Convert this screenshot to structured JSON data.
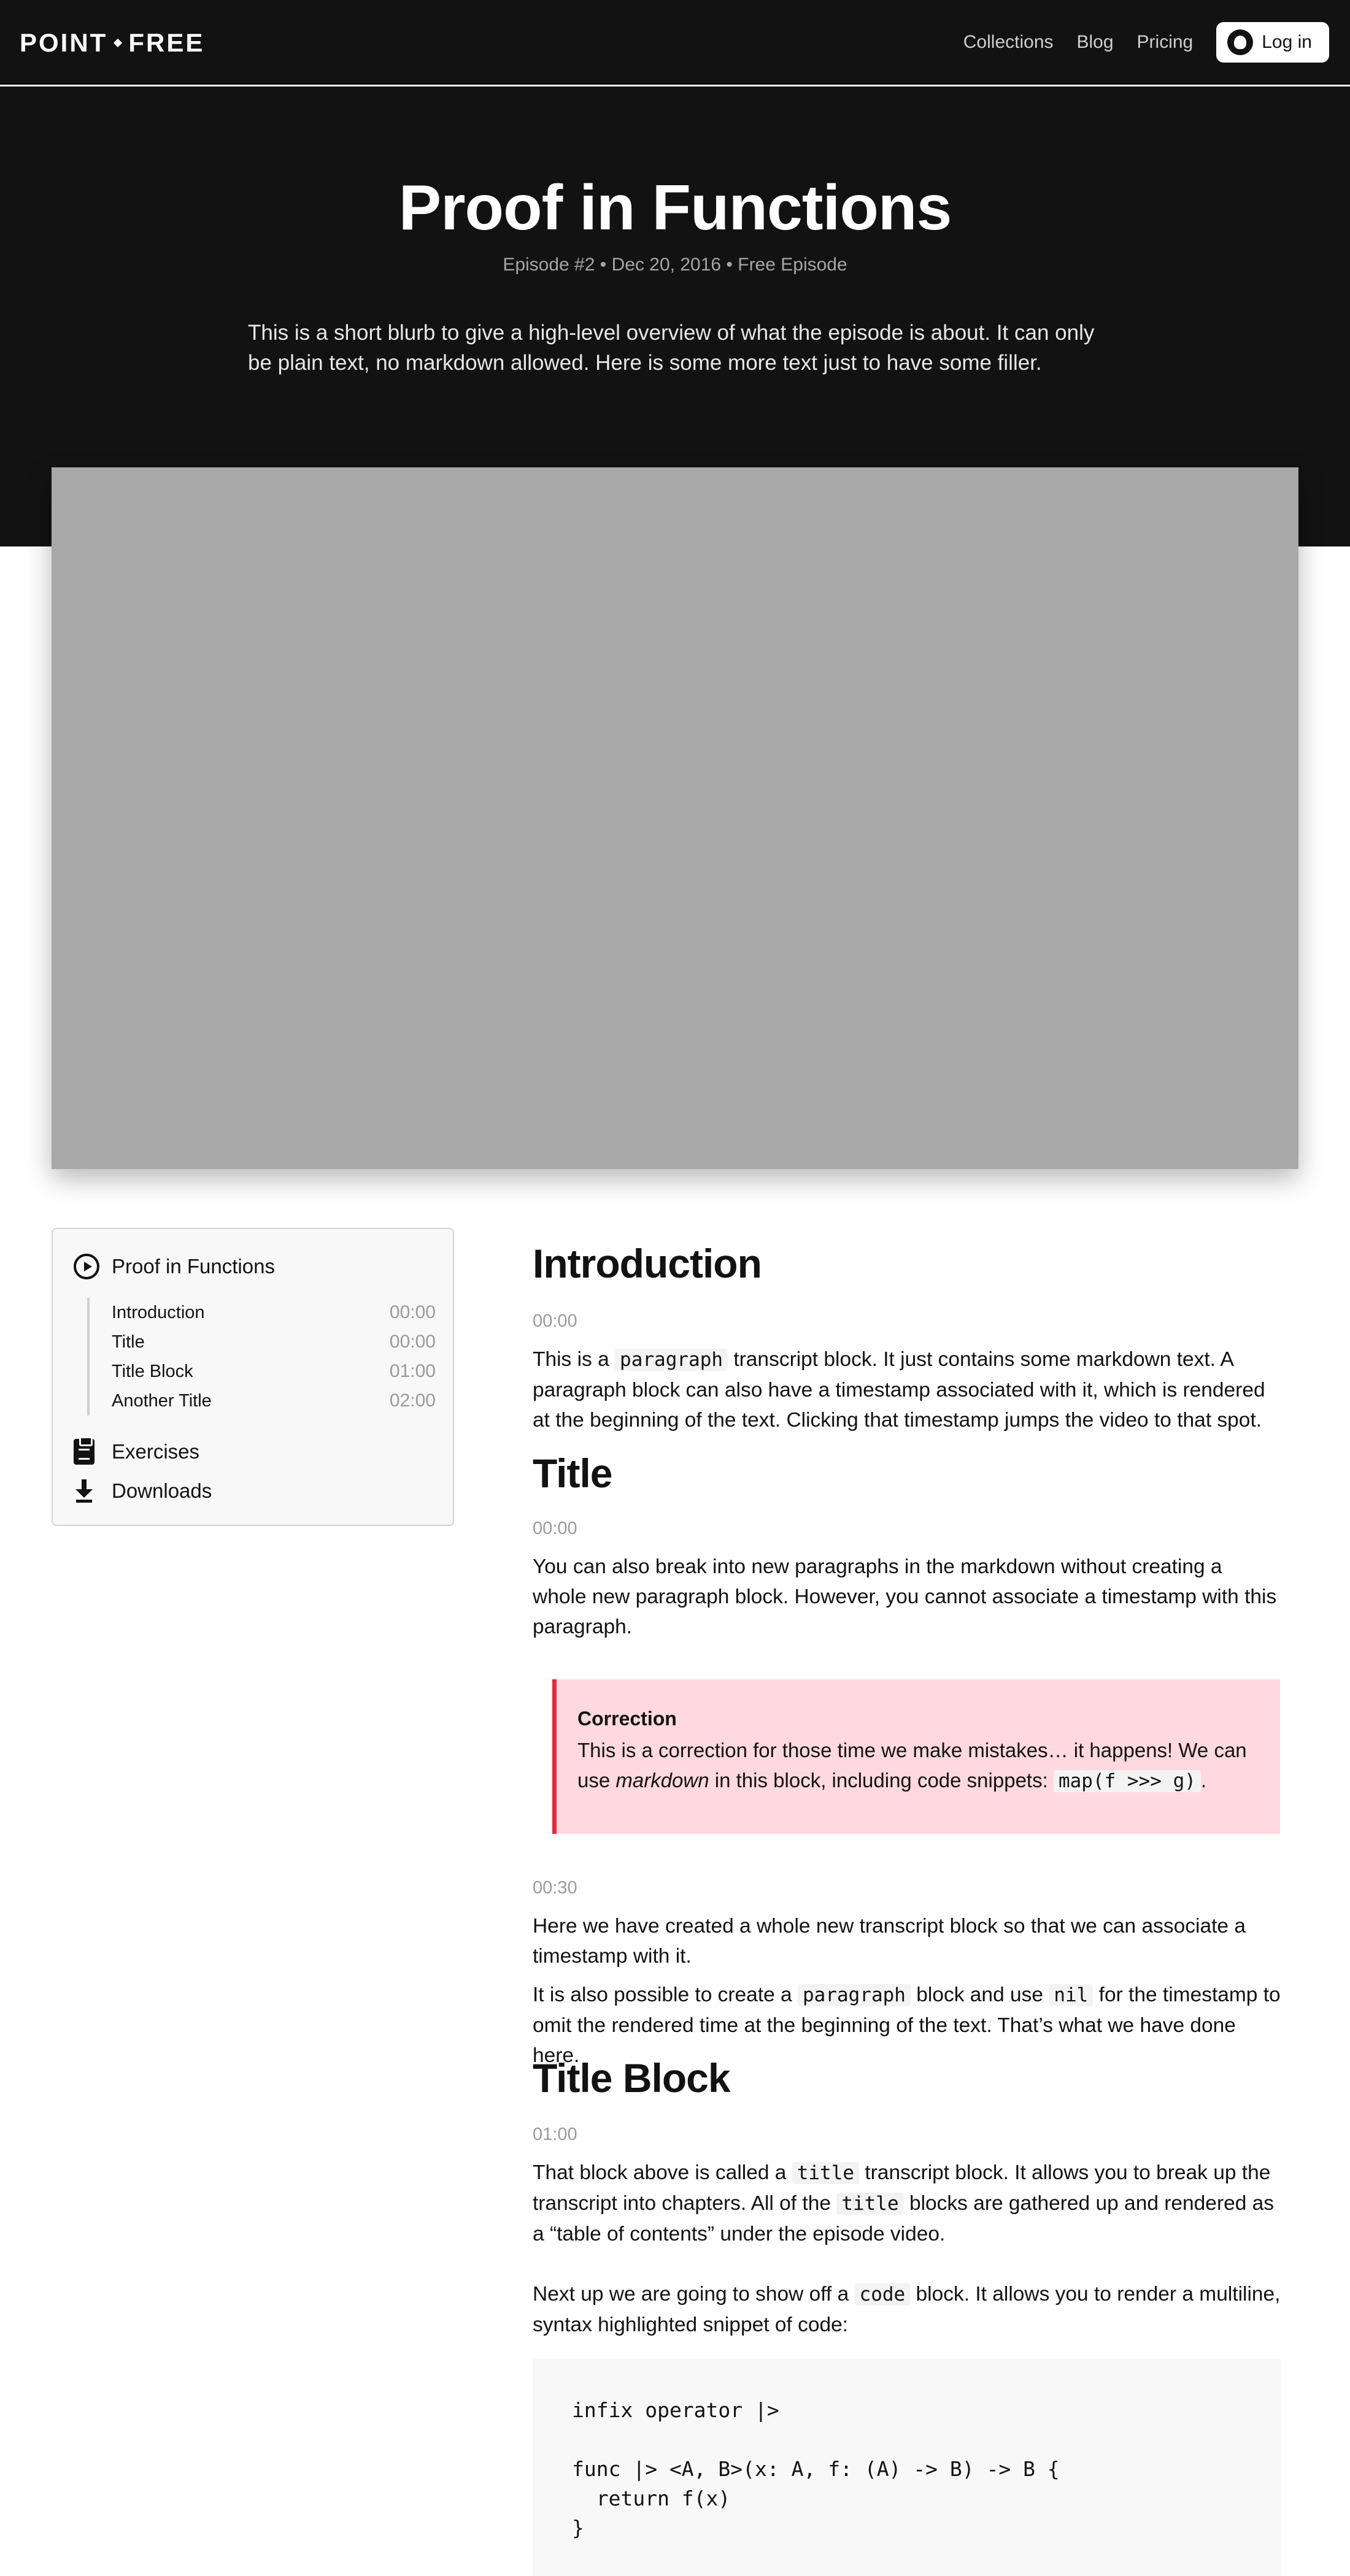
{
  "nav": {
    "logo_left": "POINT",
    "logo_right": "FREE",
    "links": [
      "Collections",
      "Blog",
      "Pricing"
    ],
    "login_label": "Log in"
  },
  "hero": {
    "title": "Proof in Functions",
    "meta": "Episode #2 • Dec 20, 2016 • Free Episode",
    "blurb": "This is a short blurb to give a high-level overview of what the episode is about. It can only be plain text, no markdown allowed. Here is some more text just to have some filler."
  },
  "toc": {
    "episode_title": "Proof in Functions",
    "chapters": [
      {
        "title": "Introduction",
        "time": "00:00"
      },
      {
        "title": "Title",
        "time": "00:00"
      },
      {
        "title": "Title Block",
        "time": "01:00"
      },
      {
        "title": "Another Title",
        "time": "02:00"
      }
    ],
    "exercises_label": "Exercises",
    "downloads_label": "Downloads"
  },
  "transcript": {
    "intro": {
      "heading": "Introduction",
      "time": "00:00",
      "p_a": "This is a ",
      "p_code": "paragraph",
      "p_b": " transcript block. It just contains some markdown text. A paragraph block can also have a timestamp associated with it, which is rendered at the beginning of the text. Clicking that timestamp jumps the video to that spot."
    },
    "title_section": {
      "heading": "Title",
      "time": "00:00",
      "p": "You can also break into new paragraphs in the markdown without creating a whole new paragraph block. However, you cannot associate a timestamp with this paragraph."
    },
    "correction": {
      "title": "Correction",
      "body_a": "This is a correction for those time we make mistakes… it happens! We can use ",
      "body_em": "markdown",
      "body_b": " in this block, including code snippets: ",
      "body_code": "map(f >>> g)",
      "body_c": "."
    },
    "block_030": {
      "time": "00:30",
      "p1": "Here we have created a whole new transcript block so that we can associate a timestamp with it.",
      "p2_a": "It is also possible to create a ",
      "p2_code1": "paragraph",
      "p2_b": " block and use ",
      "p2_code2": "nil",
      "p2_c": " for the timestamp to omit the rendered time at the beginning of the text. That’s what we have done here."
    },
    "title_block": {
      "heading": "Title Block",
      "time": "01:00",
      "p1_a": "That block above is called a ",
      "p1_code1": "title",
      "p1_b": " transcript block. It allows you to break up the transcript into chapters. All of the ",
      "p1_code2": "title",
      "p1_c": " blocks are gathered up and rendered as a “table of contents” under the episode video.",
      "p2_a": "Next up we are going to show off a ",
      "p2_code": "code",
      "p2_b": " block. It allows you to render a multiline, syntax highlighted snippet of code:"
    },
    "code_snippet": "infix operator |>\n\nfunc |> <A, B>(x: A, f: (A) -> B) -> B {\n  return f(x)\n}"
  }
}
